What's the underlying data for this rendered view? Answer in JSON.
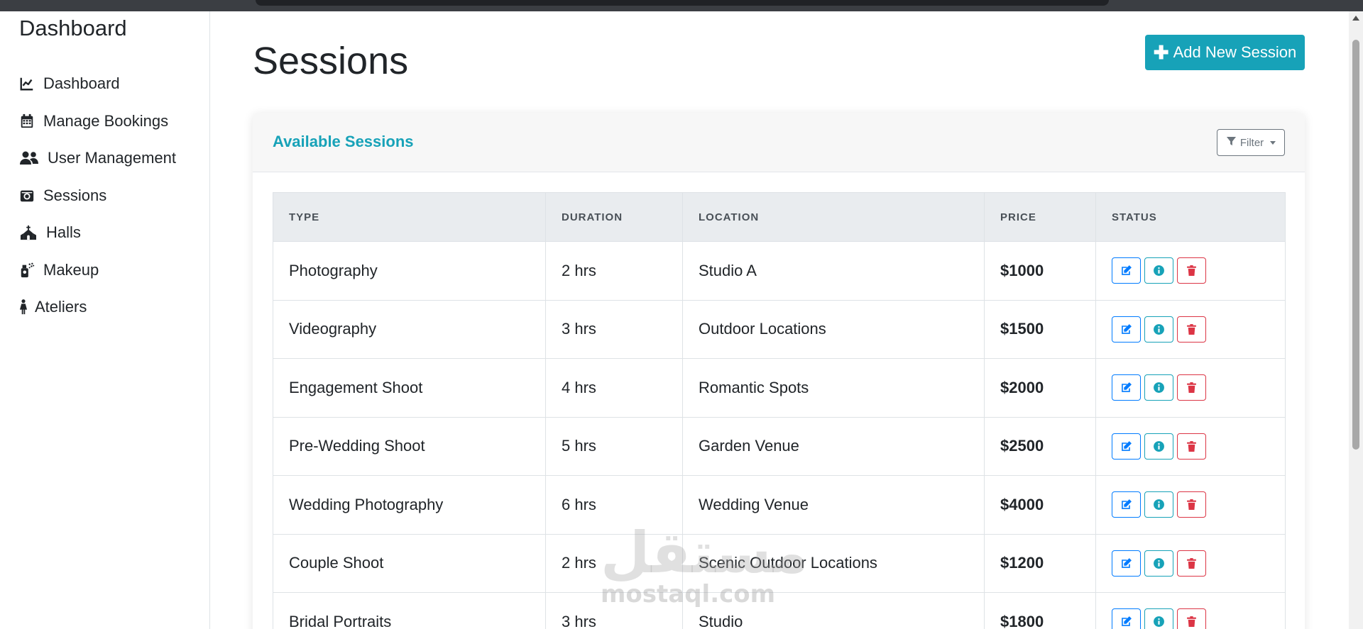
{
  "sidebar": {
    "brand": "Dashboard",
    "items": [
      {
        "label": "Dashboard",
        "icon": "chart-line-icon"
      },
      {
        "label": "Manage Bookings",
        "icon": "calendar-icon"
      },
      {
        "label": "User Management",
        "icon": "users-icon"
      },
      {
        "label": "Sessions",
        "icon": "camera-icon"
      },
      {
        "label": "Halls",
        "icon": "church-icon"
      },
      {
        "label": "Makeup",
        "icon": "spray-can-icon"
      },
      {
        "label": "Ateliers",
        "icon": "female-icon"
      }
    ]
  },
  "main": {
    "title": "Sessions",
    "add_button": "Add New Session",
    "card": {
      "title": "Available Sessions",
      "filter_label": "Filter"
    },
    "table": {
      "headers": [
        "Type",
        "Duration",
        "Location",
        "Price",
        "Status"
      ],
      "rows": [
        {
          "type": "Photography",
          "duration": "2 hrs",
          "location": "Studio A",
          "price": "$1000"
        },
        {
          "type": "Videography",
          "duration": "3 hrs",
          "location": "Outdoor Locations",
          "price": "$1500"
        },
        {
          "type": "Engagement Shoot",
          "duration": "4 hrs",
          "location": "Romantic Spots",
          "price": "$2000"
        },
        {
          "type": "Pre-Wedding Shoot",
          "duration": "5 hrs",
          "location": "Garden Venue",
          "price": "$2500"
        },
        {
          "type": "Wedding Photography",
          "duration": "6 hrs",
          "location": "Wedding Venue",
          "price": "$4000"
        },
        {
          "type": "Couple Shoot",
          "duration": "2 hrs",
          "location": "Scenic Outdoor Locations",
          "price": "$1200"
        },
        {
          "type": "Bridal Portraits",
          "duration": "3 hrs",
          "location": "Studio",
          "price": "$1800"
        }
      ]
    }
  },
  "watermark": {
    "arabic": "مستقل",
    "latin": "mostaql.com"
  },
  "colors": {
    "accent": "#17a2b8",
    "edit": "#007bff",
    "delete": "#dc3545",
    "secondary": "#6c757d"
  }
}
